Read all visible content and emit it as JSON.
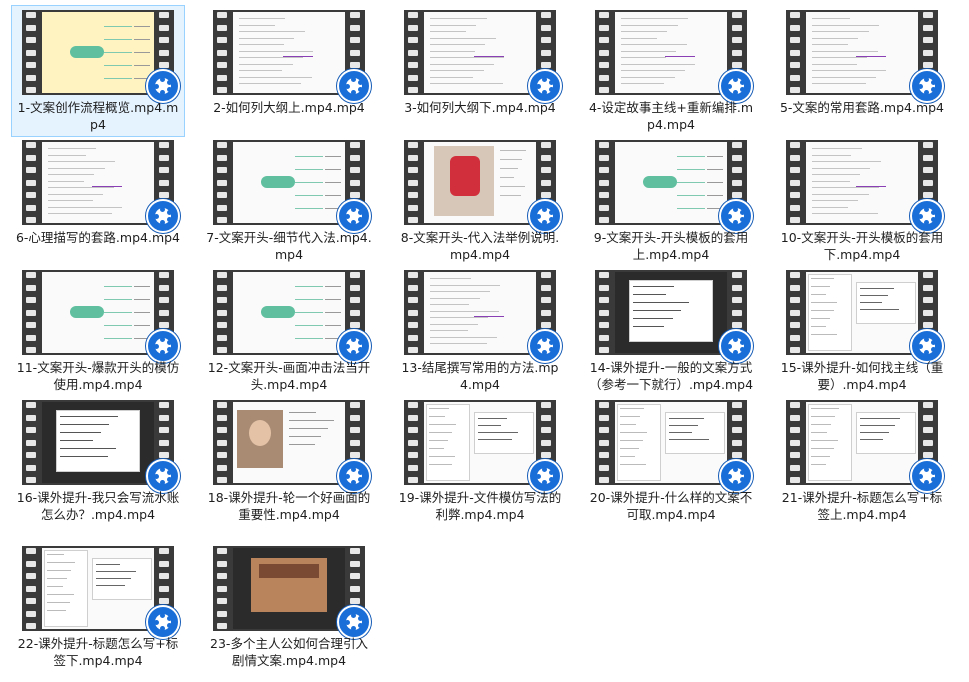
{
  "files": [
    {
      "label": "1-文案创作流程概览.mp4.mp4",
      "thumb": "mindmap-yellow"
    },
    {
      "label": "2-如何列大纲上.mp4.mp4",
      "thumb": "doc-text"
    },
    {
      "label": "3-如何列大纲下.mp4.mp4",
      "thumb": "doc-text"
    },
    {
      "label": "4-设定故事主线+重新编排.mp4.mp4",
      "thumb": "doc-text"
    },
    {
      "label": "5-文案的常用套路.mp4.mp4",
      "thumb": "doc-text"
    },
    {
      "label": "6-心理描写的套路.mp4.mp4",
      "thumb": "doc-text"
    },
    {
      "label": "7-文案开头-细节代入法.mp4.mp4",
      "thumb": "mindmap"
    },
    {
      "label": "8-文案开头-代入法举例说明.mp4.mp4",
      "thumb": "photo-bag"
    },
    {
      "label": "9-文案开头-开头模板的套用上.mp4.mp4",
      "thumb": "mindmap"
    },
    {
      "label": "10-文案开头-开头模板的套用下.mp4.mp4",
      "thumb": "doc-text"
    },
    {
      "label": "11-文案开头-爆款开头的模仿使用.mp4.mp4",
      "thumb": "mindmap"
    },
    {
      "label": "12-文案开头-画面冲击法当开头.mp4.mp4",
      "thumb": "mindmap"
    },
    {
      "label": "13-结尾撰写常用的方法.mp4.mp4",
      "thumb": "doc-text"
    },
    {
      "label": "14-课外提升-一般的文案方式（参考一下就行）.mp4.mp4",
      "thumb": "dark-note"
    },
    {
      "label": "15-课外提升-如何找主线（重要）.mp4.mp4",
      "thumb": "doc-split"
    },
    {
      "label": "16-课外提升-我只会写流水账怎么办？.mp4.mp4",
      "thumb": "dark-note"
    },
    {
      "label": "18-课外提升-轮一个好画面的重要性.mp4.mp4",
      "thumb": "photo-face"
    },
    {
      "label": "19-课外提升-文件模仿写法的利弊.mp4.mp4",
      "thumb": "doc-split"
    },
    {
      "label": "20-课外提升-什么样的文案不可取.mp4.mp4",
      "thumb": "doc-split"
    },
    {
      "label": "21-课外提升-标题怎么写+标签上.mp4.mp4",
      "thumb": "doc-split"
    },
    {
      "label": "22-课外提升-标题怎么写+标签下.mp4.mp4",
      "thumb": "doc-split"
    },
    {
      "label": "23-多个主人公如何合理引入剧情文案.mp4.mp4",
      "thumb": "photo-house"
    }
  ],
  "colors": {
    "badge": "#1a6ed8",
    "film": "#3a3a3a",
    "selection": "#e5f3ff"
  },
  "icon": "video-player-badge-icon"
}
